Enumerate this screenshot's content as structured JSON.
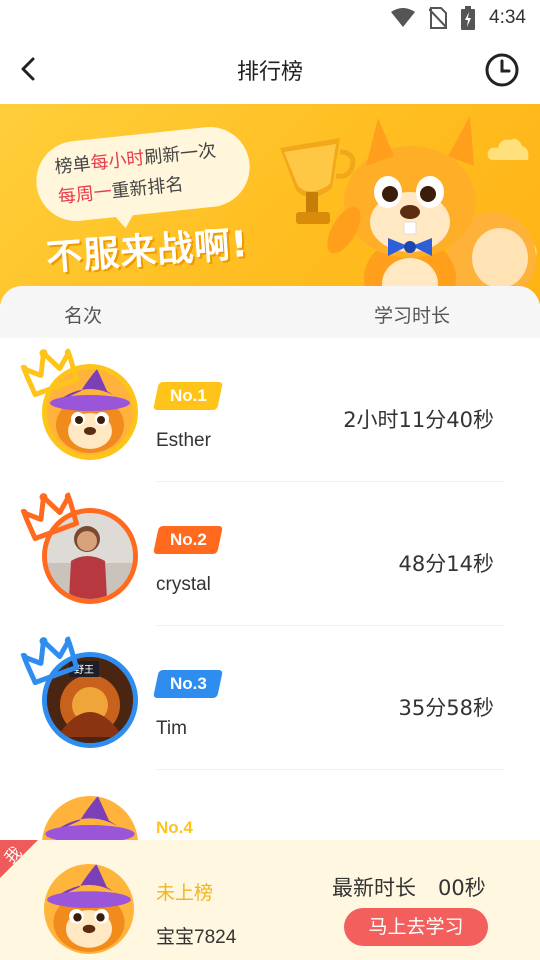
{
  "status_bar": {
    "time": "4:34",
    "icons": [
      "wifi-icon",
      "no-sim-icon",
      "battery-charging-icon"
    ]
  },
  "nav": {
    "title": "排行榜",
    "back_icon": "chevron-left-icon",
    "history_icon": "clock-icon"
  },
  "banner": {
    "bubble_line1_a": "榜单",
    "bubble_line1_b": "每小时",
    "bubble_line1_c": "刷新一次",
    "bubble_line2_a": "每周一",
    "bubble_line2_b": "重新排名",
    "slogan": "不服来战啊!"
  },
  "list_header": {
    "rank": "名次",
    "study_time": "学习时长"
  },
  "ranking": [
    {
      "rank_label": "No.1",
      "name": "Esther",
      "duration": "2小时11分40秒",
      "color": "#ffc419"
    },
    {
      "rank_label": "No.2",
      "name": "crystal",
      "duration": "48分14秒",
      "color": "#ff6a1f"
    },
    {
      "rank_label": "No.3",
      "name": "Tim",
      "duration": "35分58秒",
      "color": "#2f8df0"
    },
    {
      "rank_label": "No.4",
      "name": "",
      "duration": "",
      "color": "#ffc419"
    }
  ],
  "avatar3_badge": "野王",
  "me": {
    "tag": "我",
    "status": "未上榜",
    "name": "宝宝7824",
    "latest_label": "最新时长",
    "latest_value": "00秒",
    "study_button": "马上去学习"
  }
}
